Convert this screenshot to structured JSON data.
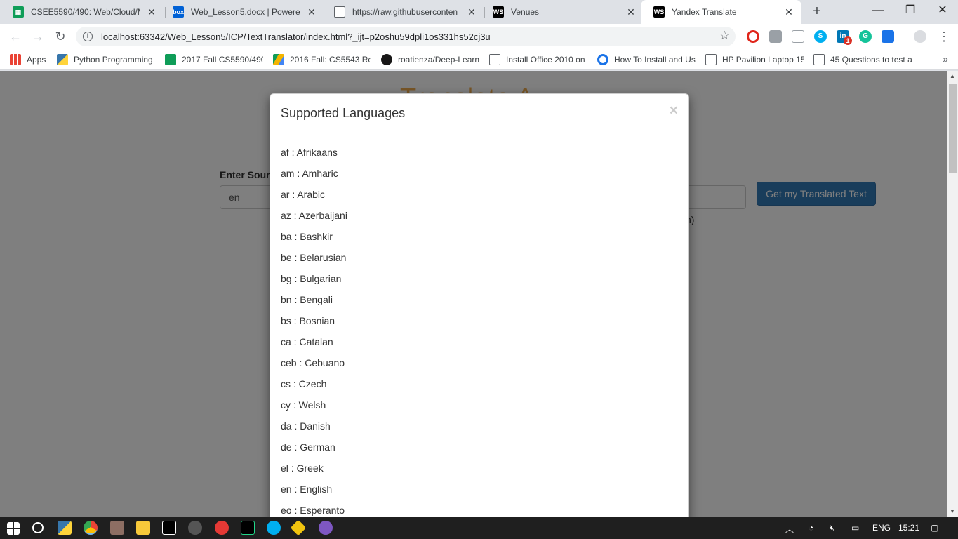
{
  "tabs": [
    {
      "title": "CSEE5590/490: Web/Cloud/Mo",
      "icon": "sheets-icon",
      "color": "#0f9d58",
      "active": false
    },
    {
      "title": "Web_Lesson5.docx | Powered b",
      "icon": "box-icon",
      "color": "#0061d5",
      "active": false
    },
    {
      "title": "https://raw.githubuserconten",
      "icon": "file-icon",
      "color": "#ffffff",
      "active": false
    },
    {
      "title": "Venues",
      "icon": "webstorm-icon",
      "color": "#000000",
      "active": false
    },
    {
      "title": "Yandex Translate",
      "icon": "webstorm-icon",
      "color": "#000000",
      "active": true
    }
  ],
  "url": "localhost:63342/Web_Lesson5/ICP/TextTranslator/index.html?_ijt=p2oshu59dpli1os331hs52cj3u",
  "bookmarks": [
    {
      "label": "Apps",
      "icon": "apps-icon"
    },
    {
      "label": "Python Programming",
      "icon": "python-icon"
    },
    {
      "label": "2017 Fall CS5590/490",
      "icon": "sheets-icon"
    },
    {
      "label": "2016 Fall: CS5543 Re",
      "icon": "drive-icon"
    },
    {
      "label": "roatienza/Deep-Learn",
      "icon": "github-icon"
    },
    {
      "label": "Install Office 2010 on",
      "icon": "page-icon"
    },
    {
      "label": "How To Install and Us",
      "icon": "loader-icon"
    },
    {
      "label": "HP Pavilion Laptop 15",
      "icon": "page-icon"
    },
    {
      "label": "45 Questions to test a",
      "icon": "page-icon"
    }
  ],
  "page": {
    "app_title": "Translate A",
    "source_label": "Enter Sour",
    "source_value": "en",
    "translate_button": "Get my Translated Text",
    "hint": "sh)"
  },
  "modal": {
    "title": "Supported Languages",
    "close": "×",
    "languages": [
      "af : Afrikaans",
      "am : Amharic",
      "ar : Arabic",
      "az : Azerbaijani",
      "ba : Bashkir",
      "be : Belarusian",
      "bg : Bulgarian",
      "bn : Bengali",
      "bs : Bosnian",
      "ca : Catalan",
      "ceb : Cebuano",
      "cs : Czech",
      "cy : Welsh",
      "da : Danish",
      "de : German",
      "el : Greek",
      "en : English",
      "eo : Esperanto"
    ]
  },
  "taskbar": {
    "language": "ENG",
    "time": "15:21"
  },
  "extension_badge": "1"
}
